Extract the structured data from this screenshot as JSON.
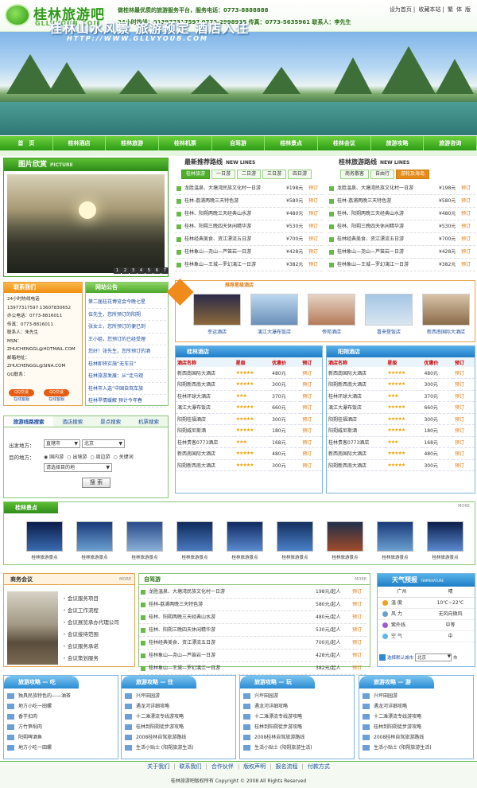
{
  "header": {
    "logo_cn": "桂林旅游吧",
    "logo_en": "GLLVYOUB.COM",
    "slogan": "做桂林最优质的旅游服务平台，服务电话：0773-8888888",
    "hotline": "24小时热线：013977317597 0773-2998935 传真：0773-5635961 联系人：李先生",
    "links": [
      "设为首页",
      "收藏本站",
      "繁",
      "体",
      "版"
    ]
  },
  "banner": {
    "title": "桂林山水风景  旅游预定  酒店入住",
    "url": "HTTP://WWW.GLLVYOUB.COM"
  },
  "nav": [
    "首　页",
    "桂林酒店",
    "桂林旅游",
    "桂林机票",
    "自驾游",
    "桂林景点",
    "桂林会议",
    "旅游攻略",
    "旅游咨询"
  ],
  "gallery": {
    "title": "图片欣赏",
    "sub": "PICTURE",
    "nums": [
      "1",
      "2",
      "3",
      "4",
      "5",
      "6",
      "7"
    ]
  },
  "routes_new": {
    "title": "最新推荐路线",
    "sub": "NEW LINES",
    "tabs": [
      "桂林旅游",
      "一日游",
      "二日游",
      "三日游",
      "四日游"
    ],
    "items": [
      {
        "n": "龙胜温泉、大塘湾民族文化村一日游",
        "p": "¥198元"
      },
      {
        "n": "桂林-荔浦两晚三天特色游",
        "p": "¥580元"
      },
      {
        "n": "桂林、阳朔两晚三天经典山水游",
        "p": "¥480元"
      },
      {
        "n": "桂林、阳朔三晚四天休闲精华游",
        "p": "¥530元"
      },
      {
        "n": "桂林经典美食、资江漂流五日游",
        "p": "¥700元"
      },
      {
        "n": "桂林象山—尧山—芦笛岩一日游",
        "p": "¥428元"
      },
      {
        "n": "桂林象山—王城—罗幻漓江一日游",
        "p": "¥382元"
      }
    ],
    "action": "预订"
  },
  "routes_gl": {
    "title": "桂林旅游路线",
    "sub": "NEW LINES",
    "tabs": [
      "商务散客",
      "自由行",
      "游轮及海岛"
    ],
    "items": [
      {
        "n": "龙胜温泉、大塘湾民族文化村一日游",
        "p": "¥198元"
      },
      {
        "n": "桂林-荔浦两晚三天特色游",
        "p": "¥580元"
      },
      {
        "n": "桂林、阳朔两晚三天经典山水游",
        "p": "¥480元"
      },
      {
        "n": "桂林、阳朔三晚四天休闲精华游",
        "p": "¥530元"
      },
      {
        "n": "桂林经典美食、资江漂流五日游",
        "p": "¥700元"
      },
      {
        "n": "桂林象山—尧山—芦笛岩一日游",
        "p": "¥428元"
      },
      {
        "n": "桂林象山—王城—罗幻漓江一日游",
        "p": "¥382元"
      }
    ],
    "action": "预订"
  },
  "contact": {
    "title": "联系我们",
    "lines": [
      "24小时热线电话",
      "13977317597 13607830652",
      "办公电话：0773-8816011",
      "传真：0773-8816011",
      "联系人：朱先生",
      "MSN：",
      "ZHUCHENGGL@HOTMAIL.COM",
      "邮箱地址：",
      "ZHUCHENGGL@SINA.COM",
      "QQ联系："
    ],
    "qq": [
      "在线客服",
      "在线客服"
    ]
  },
  "notice": {
    "title": "网站公告",
    "items": [
      "第二届桂花博览会今晚七星",
      "伍先生，您所预订的阳朔",
      "张女士，您所预订的便已到",
      "王小姐，您预订的已经受理",
      "您好！张先生，您所预订的酒",
      "桂林即将实施“无车日”",
      "桂林旅游发展：从“走马观",
      "桂林市入选“中国自驾车旅",
      "桂林旱情缓解 预计今年春"
    ]
  },
  "hotelpics": {
    "title": "推荐星级酒店",
    "items": [
      "幸运酒店",
      "漓江大瀑布饭店",
      "帝苑酒店",
      "喜来登饭店",
      "新西南国际大酒店"
    ]
  },
  "hotels_gl": {
    "title": "桂林酒店",
    "cols": [
      "酒店名称",
      "星级",
      "优惠价",
      "预订"
    ],
    "rows": [
      [
        "新西南国际大酒店",
        "★★★★★",
        "480元",
        "预订"
      ],
      [
        "阳朔新西南大酒店",
        "★★★★★",
        "300元",
        "预订"
      ],
      [
        "桂林环球大酒店",
        "★★★",
        "370元",
        "预订"
      ],
      [
        "漓江大瀑布饭店",
        "★★★★★",
        "660元",
        "预订"
      ],
      [
        "阳朔桂福酒店",
        "★★★★★",
        "300元",
        "预订"
      ],
      [
        "阳朔威尼斯酒",
        "★★★★★",
        "180元",
        "预订"
      ],
      [
        "桂林贵客0773酒店",
        "★★★",
        "168元",
        "预订"
      ],
      [
        "新西南国际大酒店",
        "★★★★★",
        "480元",
        "预订"
      ],
      [
        "阳朔新西南大酒店",
        "★★★★★",
        "300元",
        "预订"
      ]
    ]
  },
  "hotels_ys": {
    "title": "阳朔酒店",
    "cols": [
      "酒店名称",
      "星级",
      "优惠价",
      "预订"
    ],
    "rows": [
      [
        "新西南国际大酒店",
        "★★★★★",
        "480元",
        "预订"
      ],
      [
        "阳朔新西南大酒店",
        "★★★★★",
        "300元",
        "预订"
      ],
      [
        "桂林环球大酒店",
        "★★★",
        "370元",
        "预订"
      ],
      [
        "漓江大瀑布饭店",
        "★★★★★",
        "660元",
        "预订"
      ],
      [
        "阳朔桂福酒店",
        "★★★★★",
        "300元",
        "预订"
      ],
      [
        "阳朔威尼斯酒",
        "★★★★★",
        "180元",
        "预订"
      ],
      [
        "桂林贵客0773酒店",
        "★★★",
        "168元",
        "预订"
      ],
      [
        "新西南国际大酒店",
        "★★★★★",
        "480元",
        "预订"
      ],
      [
        "阳朔新西南大酒店",
        "★★★★★",
        "300元",
        "预订"
      ]
    ]
  },
  "search": {
    "tabs": [
      "旅游线路搜索",
      "酒店搜索",
      "景点搜索",
      "机票搜索"
    ],
    "from_label": "出发地方：",
    "from_a": "直辖市",
    "from_b": "北京",
    "to_label": "目的地方：",
    "radios": [
      "国内游",
      "出境游",
      "周边游",
      "关键词"
    ],
    "dest": "请选择目的地",
    "button": "搜 索"
  },
  "spots": {
    "title": "桂林景点",
    "more": "MORE",
    "items": [
      "桂林旅游景点",
      "桂林旅游景点",
      "桂林旅游景点",
      "桂林旅游景点",
      "桂林旅游景点",
      "桂林旅游景点",
      "桂林旅游景点",
      "桂林旅游景点",
      "桂林旅游景点"
    ]
  },
  "meeting": {
    "title": "商务会议",
    "more": "MORE",
    "items": [
      "会议服务项目",
      "会议工作流程",
      "会议展览承办代理公司",
      "会议接待范围",
      "会议服务承诺",
      "会议策划服务"
    ]
  },
  "zijia": {
    "title": "自驾游",
    "more": "MORE",
    "items": [
      {
        "n": "龙胜温泉、大塘湾民族文化村一日游",
        "p": "198元/起人"
      },
      {
        "n": "桂林-荔浦两晚三天特色游",
        "p": "580元/起人"
      },
      {
        "n": "桂林、阳朔两晚三天经典山水游",
        "p": "480元/起人"
      },
      {
        "n": "桂林、阳朔三晚四天休闲精华游",
        "p": "530元/起人"
      },
      {
        "n": "桂林经典美食、资江漂流五日游",
        "p": "700元/起人"
      },
      {
        "n": "桂林象山—尧山—芦笛岩一日游",
        "p": "428元/起人"
      },
      {
        "n": "桂林象山—王城—罗幻漓江一日游",
        "p": "382元/起人"
      }
    ],
    "action": "预订"
  },
  "weather": {
    "title": "天气预报",
    "sub": "TEMPERATURE",
    "city": "广州",
    "cond": "晴",
    "rows": [
      [
        "温 度",
        "10℃~22℃"
      ],
      [
        "风 力",
        "无风向微风"
      ],
      [
        "紫外线",
        "中等"
      ],
      [
        "空 气",
        "中"
      ]
    ],
    "select_label": "选择默认城市",
    "select_value": "北京",
    "unit": "市"
  },
  "guides": [
    {
      "title": "旅游攻略 — 吃",
      "items": [
        "独具民族特色的——油茶",
        "地方小吃一田螺",
        "香芋扣肉",
        "方竹笋焖肉",
        "阳朔啤酒鱼",
        "地方小吃一田螺"
      ]
    },
    {
      "title": "旅游攻略 — 住",
      "items": [
        "兴坪田园游",
        "遇龙河详细攻略",
        "十二滩漂流专线游攻略",
        "桂林到阳朔徒步游攻略",
        "2008桂林自驾旅游路线",
        "生活小贴士 (阳朔旅游生活)"
      ]
    },
    {
      "title": "旅游攻略 — 玩",
      "items": [
        "兴坪田园游",
        "遇龙河详细攻略",
        "十二滩漂流专线游攻略",
        "桂林到阳朔徒步游攻略",
        "2008桂林自驾旅游路线",
        "生活小贴士 (阳朔旅游生活)"
      ]
    },
    {
      "title": "旅游攻略 — 游",
      "items": [
        "兴坪田园游",
        "遇龙河详细攻略",
        "十二滩漂流专线游攻略",
        "桂林到阳朔徒步游攻略",
        "2008桂林自驾旅游路线",
        "生活小贴士 (阳朔旅游生活)"
      ]
    }
  ],
  "footer": {
    "links": [
      "关于我们",
      "联系我们",
      "合作伙伴",
      "版权声明",
      "报名流程",
      "付款方式"
    ],
    "copyright": "桂林旅游吧版权所有 Copyright © 2008 All Rights Reserved"
  }
}
